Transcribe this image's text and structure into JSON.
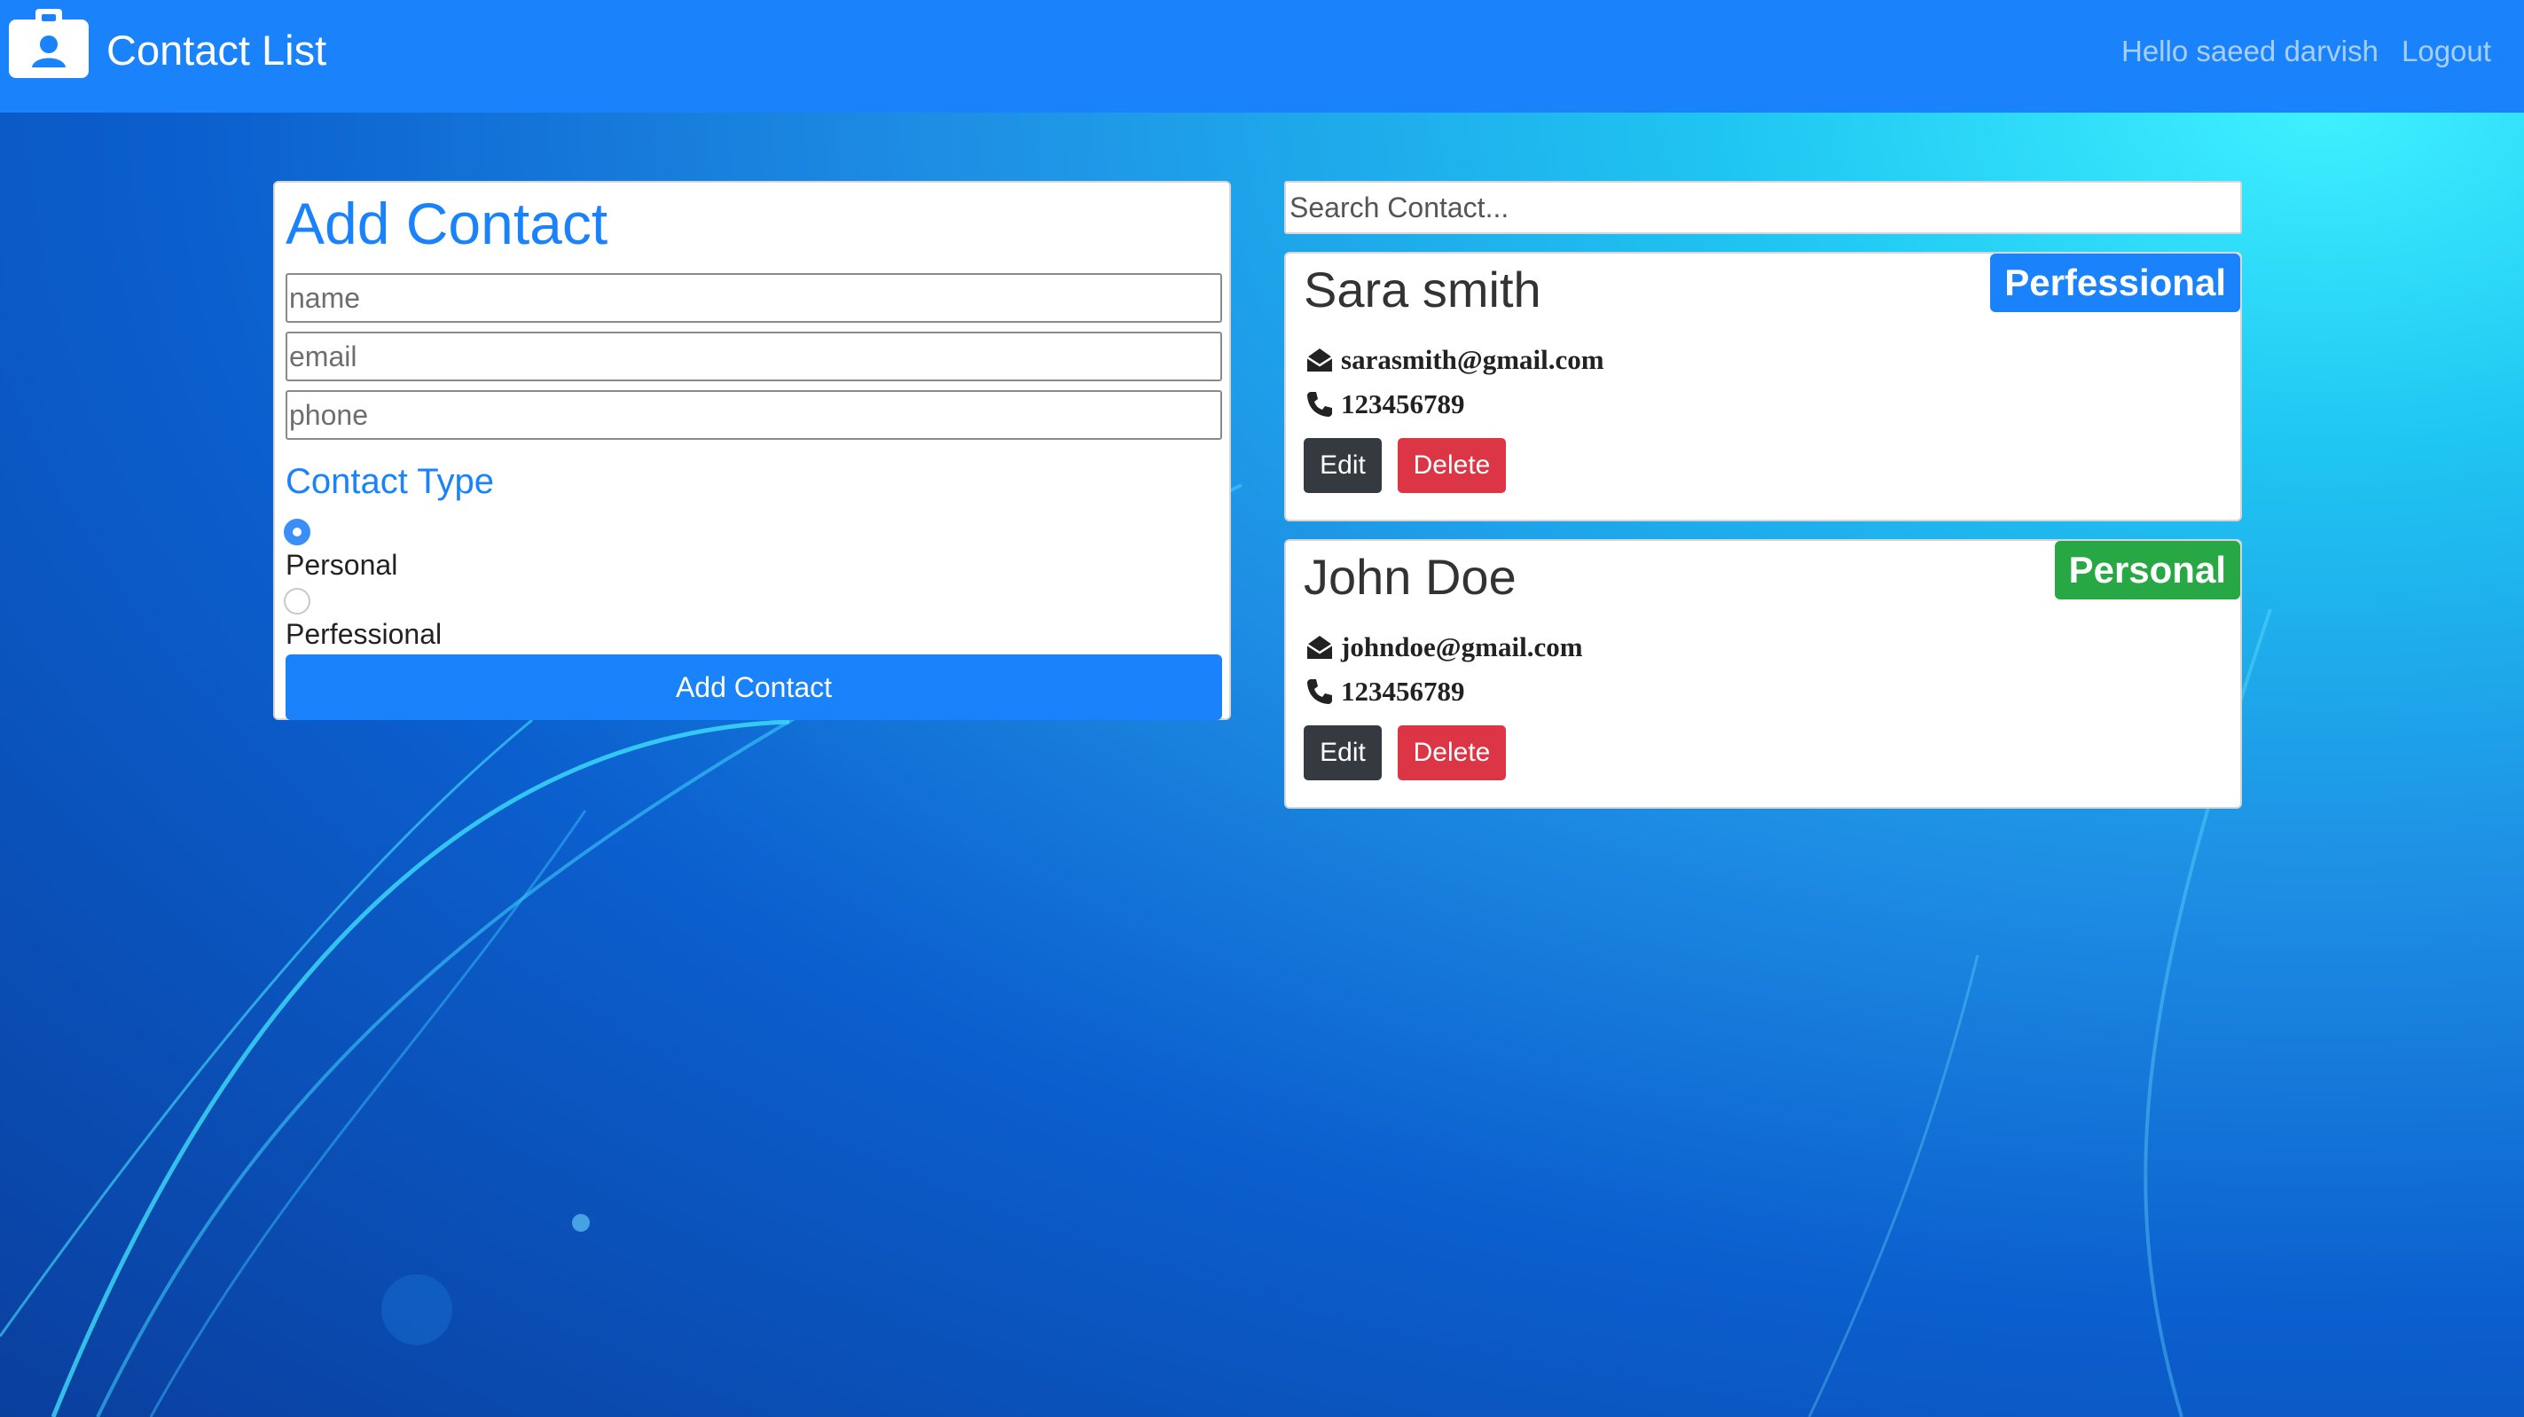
{
  "navbar": {
    "brand_icon": "id-card-icon",
    "title": "Contact List",
    "greeting": "Hello saeed darvish",
    "logout_label": "Logout",
    "background_color": "#1a82fa"
  },
  "form": {
    "title": "Add Contact",
    "name_placeholder": "name",
    "email_placeholder": "email",
    "phone_placeholder": "phone",
    "type_heading": "Contact Type",
    "options": [
      {
        "label": "Personal",
        "checked": true
      },
      {
        "label": "Perfessional",
        "checked": false
      }
    ],
    "submit_label": "Add Contact"
  },
  "search": {
    "placeholder": "Search Contact..."
  },
  "contacts": [
    {
      "name": "Sara smith",
      "type": "Perfessional",
      "type_color": "#1a82fa",
      "email": "sarasmith@gmail.com",
      "phone": "123456789",
      "edit_label": "Edit",
      "delete_label": "Delete"
    },
    {
      "name": "John Doe",
      "type": "Personal",
      "type_color": "#28a745",
      "email": "johndoe@gmail.com",
      "phone": "123456789",
      "edit_label": "Edit",
      "delete_label": "Delete"
    }
  ],
  "icons": {
    "email": "envelope-open-icon",
    "phone": "phone-icon"
  }
}
